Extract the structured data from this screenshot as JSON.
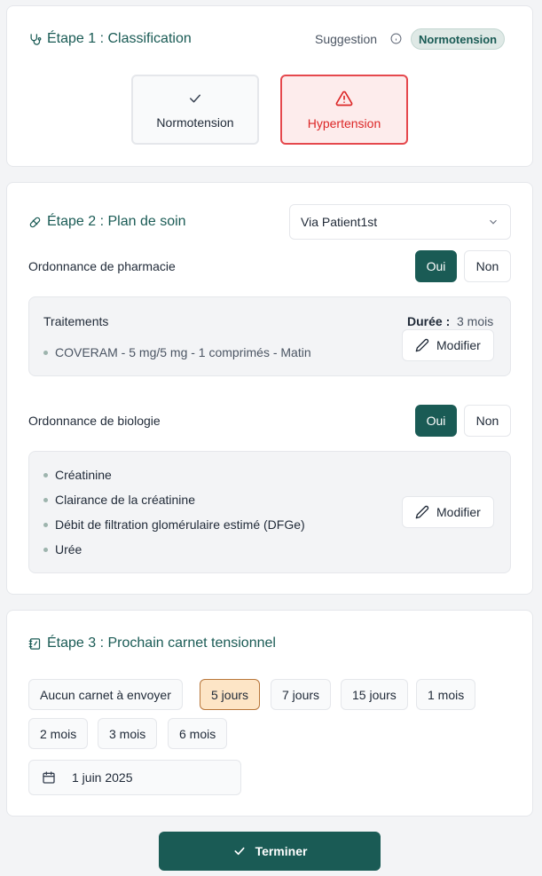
{
  "step1": {
    "title": "Étape 1 : Classification",
    "suggestion_label": "Suggestion",
    "suggestion_value": "Normotension",
    "options": [
      {
        "label": "Normotension",
        "icon": "check-icon",
        "selected": false
      },
      {
        "label": "Hypertension",
        "icon": "warning-triangle-icon",
        "selected": true
      }
    ]
  },
  "step2": {
    "title": "Étape 2 : Plan de soin",
    "via_select": "Via Patient1st",
    "pharmacy": {
      "label": "Ordonnance de pharmacie",
      "yes": "Oui",
      "no": "Non",
      "selected": "Oui",
      "treatments_title": "Traitements",
      "duration_label": "Durée :",
      "duration_value": "3 mois",
      "items": [
        "COVERAM - 5 mg/5 mg - 1 comprimés - Matin"
      ],
      "modify": "Modifier"
    },
    "biology": {
      "label": "Ordonnance de biologie",
      "yes": "Oui",
      "no": "Non",
      "selected": "Oui",
      "items": [
        "Créatinine",
        "Clairance de la créatinine",
        "Débit de filtration glomérulaire estimé (DFGe)",
        "Urée"
      ],
      "modify": "Modifier"
    }
  },
  "step3": {
    "title": "Étape 3 : Prochain carnet tensionnel",
    "options": [
      "Aucun carnet à envoyer",
      "5 jours",
      "7 jours",
      "15 jours",
      "1 mois",
      "2 mois",
      "3 mois",
      "6 mois"
    ],
    "selected": "5 jours",
    "date": "1 juin 2025"
  },
  "finish_button": "Terminer",
  "colors": {
    "primary": "#1a5b55",
    "danger": "#dc2626",
    "selected_chip": "#fde5c6"
  }
}
